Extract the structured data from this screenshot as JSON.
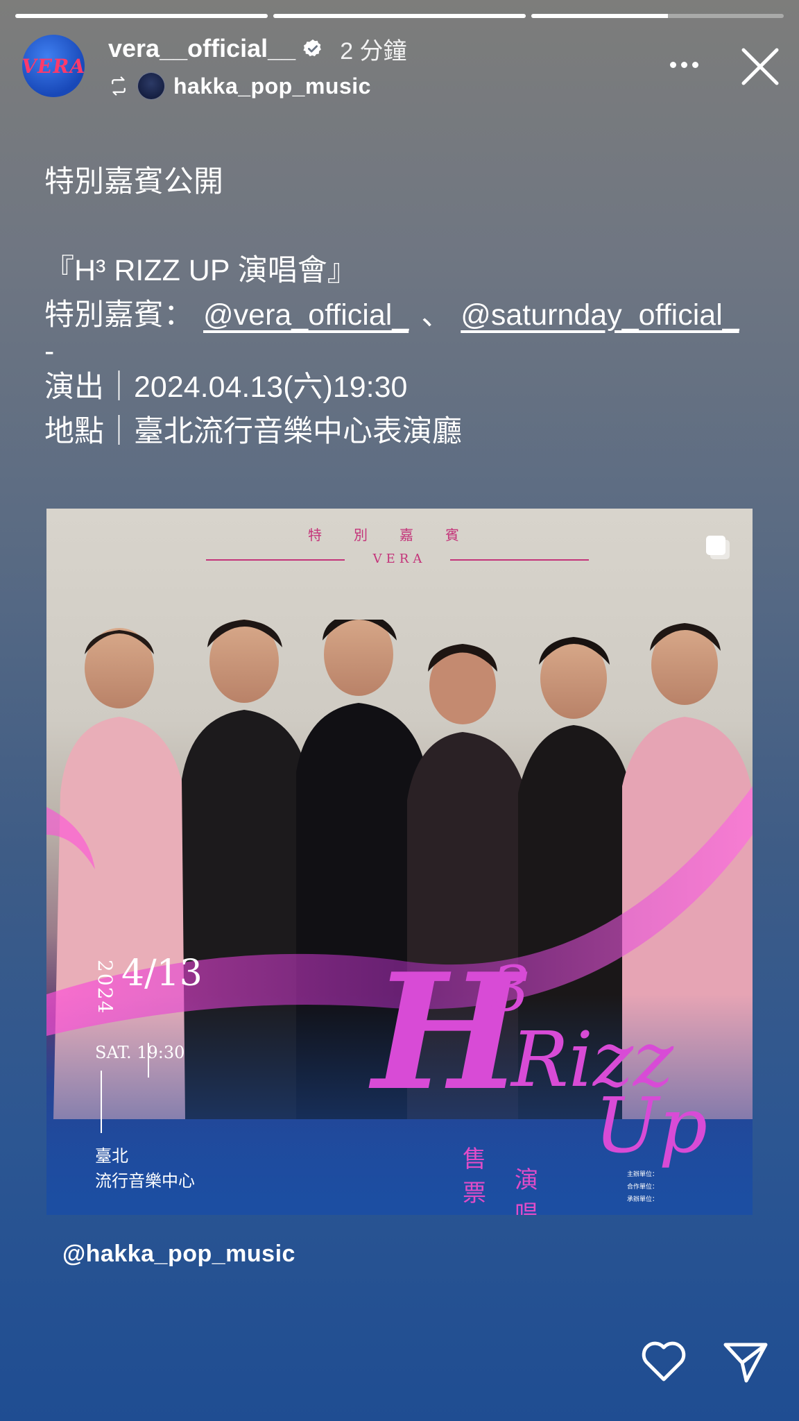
{
  "story": {
    "progress": [
      1.0,
      1.0,
      0.54
    ]
  },
  "header": {
    "avatar_text": "VERA",
    "username": "vera__official__",
    "verified": true,
    "time": "2 分鐘",
    "reposted_from": "hakka_pop_music"
  },
  "caption": {
    "line1": "特別嘉賓公開",
    "line2": "『H³ RIZZ UP 演唱會』",
    "line3_prefix": "特別嘉賓：",
    "mention1": "@vera_official_",
    "separator": "、",
    "mention2": "@saturnday_official_",
    "line4": "-",
    "line5": "演出｜2024.04.13(六)19:30",
    "line6": "地點｜臺北流行音樂中心表演廳"
  },
  "poster": {
    "guest_heading": "特別嘉賓",
    "guest_name": "VERA",
    "year": "2024",
    "month_day": "4/13",
    "day_time": "SAT. 19:30",
    "city": "臺北",
    "venue": "流行音樂中心",
    "title_h": "H",
    "title_sup": "3",
    "title_rizz": "Rizz",
    "title_up": "Up",
    "title_cn1": "售票",
    "title_cn2": "演唱會",
    "sponsor_rows": [
      "主辦單位：",
      "合作單位：",
      "承辦單位："
    ]
  },
  "mention_tag": "@hakka_pop_music",
  "colors": {
    "accent_pink": "#c4347a",
    "title_magenta": "#d84bd6"
  },
  "icons": {
    "more": "more-dots-icon",
    "close": "close-icon",
    "like": "heart-icon",
    "share": "send-icon",
    "repost": "repost-icon",
    "multi": "multiple-images-icon"
  }
}
